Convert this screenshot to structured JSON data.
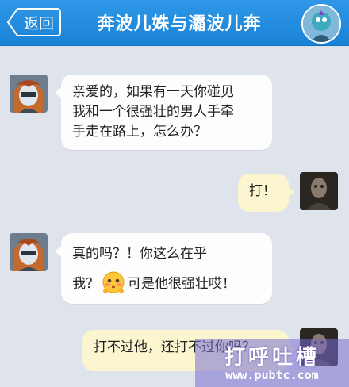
{
  "header": {
    "back_label": "返回",
    "title": "奔波儿姝与灞波儿奔"
  },
  "messages": [
    {
      "side": "left",
      "lines": [
        "亲爱的，如果有一天你碰见",
        "我和一个很强壮的男人手牵",
        "手走在路上，怎么办？"
      ]
    },
    {
      "side": "right",
      "lines": [
        "打！"
      ]
    },
    {
      "side": "left",
      "lines": [
        "真的吗？！你这么在乎"
      ],
      "line2_before": "我？",
      "line2_after": "可是他很强壮哎！",
      "emoji": "blushing-face-icon"
    },
    {
      "side": "right",
      "lines": [
        "打不过他，还打不过你吗？"
      ]
    }
  ],
  "watermark": {
    "title": "打呼吐槽",
    "url": "www.pubtc.com"
  },
  "colors": {
    "header_blue": "#1a83d6",
    "background": "#dfe4ec",
    "bubble_left": "#fdfdfd",
    "bubble_right": "#fbf6cf"
  }
}
